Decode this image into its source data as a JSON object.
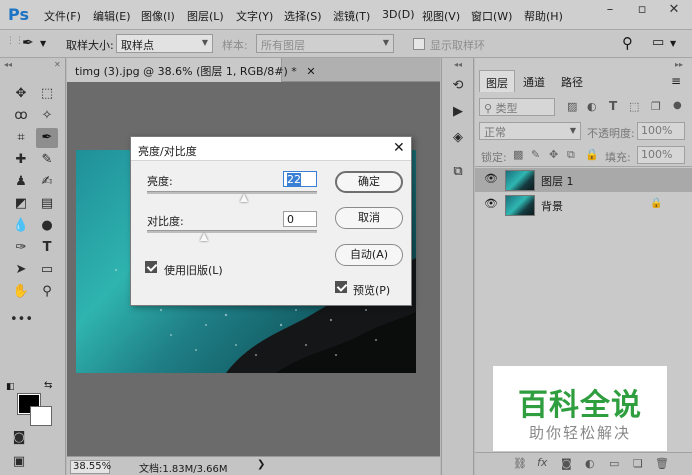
{
  "app": {
    "logo": "Ps"
  },
  "menu": [
    "文件(F)",
    "编辑(E)",
    "图像(I)",
    "图层(L)",
    "文字(Y)",
    "选择(S)",
    "滤镜(T)",
    "3D(D)",
    "视图(V)",
    "窗口(W)",
    "帮助(H)"
  ],
  "options": {
    "sample_size_label": "取样大小:",
    "sample_size_value": "取样点",
    "sample_label": "样本:",
    "sample_value": "所有图层",
    "show_ring_label": "显示取样环"
  },
  "document": {
    "tab_title": "timg (3).jpg @ 38.6% (图层 1, RGB/8#) *",
    "zoom": "38.55%",
    "doc_info": "文档:1.83M/3.66M"
  },
  "dialog": {
    "title": "亮度/对比度",
    "brightness_label": "亮度:",
    "brightness_value": "22",
    "brightness_level": 22,
    "contrast_label": "对比度:",
    "contrast_value": "0",
    "contrast_level": 0,
    "legacy_label": "使用旧版(L)",
    "legacy_checked": true,
    "ok_label": "确定",
    "cancel_label": "取消",
    "auto_label": "自动(A)",
    "preview_label": "预览(P)",
    "preview_checked": true
  },
  "layers_panel": {
    "tabs": [
      "图层",
      "通道",
      "路径"
    ],
    "filter_kind": "类型",
    "blend_mode": "正常",
    "opacity_label": "不透明度:",
    "opacity_value": "100%",
    "lock_label": "锁定:",
    "fill_label": "填充:",
    "fill_value": "100%",
    "layers": [
      {
        "name": "图层 1",
        "selected": true,
        "locked": false
      },
      {
        "name": "背景",
        "selected": false,
        "locked": true
      }
    ]
  },
  "watermark": {
    "main": "百科全说",
    "sub": "助你轻松解决"
  },
  "colors": {
    "accent": "#1e74c4",
    "watermark_green": "#2e9e3f",
    "canvas_bg": "#6b6b6b"
  }
}
